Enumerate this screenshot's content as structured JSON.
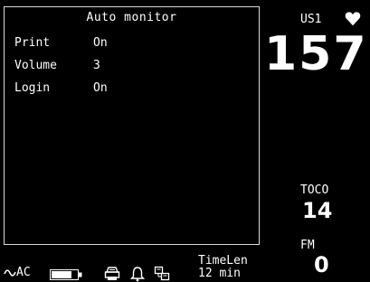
{
  "panel": {
    "title": "Auto monitor",
    "rows": [
      {
        "label": "Print",
        "value": "On"
      },
      {
        "label": "Volume",
        "value": "3"
      },
      {
        "label": "Login",
        "value": "On"
      }
    ]
  },
  "vitals": {
    "fhr_label": "US1",
    "fhr_value": "157",
    "toco_label": "TOCO",
    "toco_value": "14",
    "fm_label": "FM",
    "fm_value": "0"
  },
  "status": {
    "power_label": "AC",
    "timelen_label": "TimeLen",
    "timelen_value": "12 min"
  },
  "icons": [
    "ac-wave-icon",
    "battery-icon",
    "printer-icon",
    "bell-icon",
    "network-icon",
    "heart-icon"
  ]
}
